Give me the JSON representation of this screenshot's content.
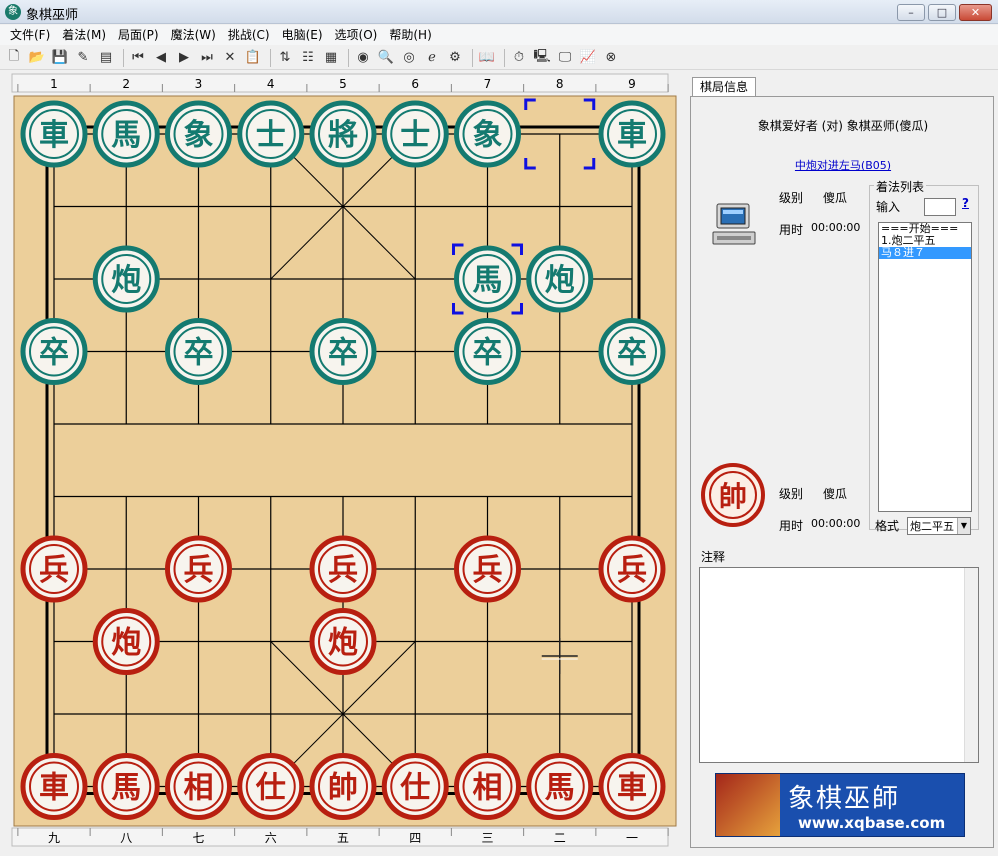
{
  "window": {
    "title": "象棋巫师",
    "app_icon_text": "象",
    "min_glyph": "–",
    "max_glyph": "□",
    "close_glyph": "✕"
  },
  "menu": [
    "文件(F)",
    "着法(M)",
    "局面(P)",
    "魔法(W)",
    "挑战(C)",
    "电脑(E)",
    "选项(O)",
    "帮助(H)"
  ],
  "toolbar": [
    {
      "name": "new-icon",
      "glyph": "🗋"
    },
    {
      "name": "open-icon",
      "glyph": "📂"
    },
    {
      "name": "save-icon",
      "glyph": "💾"
    },
    {
      "name": "edit-icon",
      "glyph": "✎"
    },
    {
      "name": "properties-icon",
      "glyph": "▤"
    },
    {
      "sep": true
    },
    {
      "name": "first-move-icon",
      "glyph": "⏮"
    },
    {
      "name": "prev-move-icon",
      "glyph": "◀"
    },
    {
      "name": "next-move-icon",
      "glyph": "▶"
    },
    {
      "name": "last-move-icon",
      "glyph": "⏭"
    },
    {
      "name": "delete-icon",
      "glyph": "✕"
    },
    {
      "name": "paste-icon",
      "glyph": "📋"
    },
    {
      "sep": true
    },
    {
      "name": "flip-board-icon",
      "glyph": "⇅"
    },
    {
      "name": "tree-icon",
      "glyph": "☷"
    },
    {
      "name": "grid-icon",
      "glyph": "▦"
    },
    {
      "sep": true
    },
    {
      "name": "colors-icon",
      "glyph": "◉"
    },
    {
      "name": "search-icon",
      "glyph": "🔍"
    },
    {
      "name": "weibo-icon",
      "glyph": "◎"
    },
    {
      "name": "browser-icon",
      "glyph": "ℯ"
    },
    {
      "name": "settings-icon",
      "glyph": "⚙"
    },
    {
      "sep": true
    },
    {
      "name": "book-icon",
      "glyph": "📖"
    },
    {
      "sep": true
    },
    {
      "name": "timer-icon",
      "glyph": "⏱"
    },
    {
      "name": "computer-icon",
      "glyph": "🖳"
    },
    {
      "name": "monitor-icon",
      "glyph": "🖵"
    },
    {
      "name": "chart-icon",
      "glyph": "📈"
    },
    {
      "name": "stop-icon",
      "glyph": "⊗"
    }
  ],
  "board": {
    "top_file_labels": [
      "1",
      "2",
      "3",
      "4",
      "5",
      "6",
      "7",
      "8",
      "9"
    ],
    "bottom_file_labels": [
      "九",
      "八",
      "七",
      "六",
      "五",
      "四",
      "三",
      "二",
      "一"
    ],
    "colors": {
      "wood": "#eccf9a",
      "red_piece": "#b81f10",
      "green_piece": "#147a70",
      "select": "#1010e0"
    },
    "pieces": [
      {
        "col": 0,
        "row": 0,
        "char": "車",
        "side": "green"
      },
      {
        "col": 1,
        "row": 0,
        "char": "馬",
        "side": "green"
      },
      {
        "col": 2,
        "row": 0,
        "char": "象",
        "side": "green"
      },
      {
        "col": 3,
        "row": 0,
        "char": "士",
        "side": "green"
      },
      {
        "col": 4,
        "row": 0,
        "char": "將",
        "side": "green"
      },
      {
        "col": 5,
        "row": 0,
        "char": "士",
        "side": "green"
      },
      {
        "col": 6,
        "row": 0,
        "char": "象",
        "side": "green"
      },
      {
        "col": 8,
        "row": 0,
        "char": "車",
        "side": "green"
      },
      {
        "col": 1,
        "row": 2,
        "char": "炮",
        "side": "green"
      },
      {
        "col": 6,
        "row": 2,
        "char": "馬",
        "side": "green"
      },
      {
        "col": 7,
        "row": 2,
        "char": "炮",
        "side": "green"
      },
      {
        "col": 0,
        "row": 3,
        "char": "卒",
        "side": "green"
      },
      {
        "col": 2,
        "row": 3,
        "char": "卒",
        "side": "green"
      },
      {
        "col": 4,
        "row": 3,
        "char": "卒",
        "side": "green"
      },
      {
        "col": 6,
        "row": 3,
        "char": "卒",
        "side": "green"
      },
      {
        "col": 8,
        "row": 3,
        "char": "卒",
        "side": "green"
      },
      {
        "col": 0,
        "row": 6,
        "char": "兵",
        "side": "red"
      },
      {
        "col": 2,
        "row": 6,
        "char": "兵",
        "side": "red"
      },
      {
        "col": 4,
        "row": 6,
        "char": "兵",
        "side": "red"
      },
      {
        "col": 6,
        "row": 6,
        "char": "兵",
        "side": "red"
      },
      {
        "col": 8,
        "row": 6,
        "char": "兵",
        "side": "red"
      },
      {
        "col": 1,
        "row": 7,
        "char": "炮",
        "side": "red"
      },
      {
        "col": 4,
        "row": 7,
        "char": "炮",
        "side": "red"
      },
      {
        "col": 0,
        "row": 9,
        "char": "車",
        "side": "red"
      },
      {
        "col": 1,
        "row": 9,
        "char": "馬",
        "side": "red"
      },
      {
        "col": 2,
        "row": 9,
        "char": "相",
        "side": "red"
      },
      {
        "col": 3,
        "row": 9,
        "char": "仕",
        "side": "red"
      },
      {
        "col": 4,
        "row": 9,
        "char": "帥",
        "side": "red"
      },
      {
        "col": 5,
        "row": 9,
        "char": "仕",
        "side": "red"
      },
      {
        "col": 6,
        "row": 9,
        "char": "相",
        "side": "red"
      },
      {
        "col": 7,
        "row": 9,
        "char": "馬",
        "side": "red"
      },
      {
        "col": 8,
        "row": 9,
        "char": "車",
        "side": "red"
      }
    ],
    "selection_markers": [
      {
        "col": 7,
        "row": 0
      },
      {
        "col": 6,
        "row": 2
      }
    ],
    "cursor": {
      "col": 7,
      "row": 7.2
    }
  },
  "panel": {
    "tab_label": "棋局信息",
    "match_title": "象棋爱好者 (对) 象棋巫师(傻瓜)",
    "opening_link": "中炮对进左马(B05)",
    "top_player": {
      "level_label": "级别",
      "level_value": "傻瓜",
      "time_label": "用时",
      "time_value": "00:00:00"
    },
    "bottom_player": {
      "level_label": "级别",
      "level_value": "傻瓜",
      "time_label": "用时",
      "time_value": "00:00:00",
      "piece_char": "帥"
    },
    "moves_legend": "着法列表",
    "input_label": "输入",
    "input_value": "",
    "help_link": "?",
    "moves": [
      "===开始===",
      "1.炮二平五",
      "  马８进７"
    ],
    "selected_move_index": 2,
    "format_label": "格式",
    "format_value": "炮二平五",
    "format_arrow": "▼",
    "notes_label": "注释",
    "banner_title": "象棋巫師",
    "banner_url": "www.xqbase.com"
  }
}
